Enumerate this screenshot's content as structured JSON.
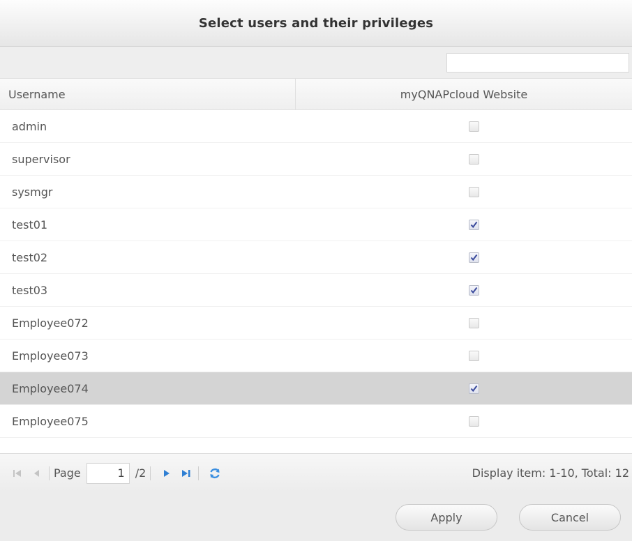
{
  "dialog": {
    "title": "Select users and their privileges"
  },
  "search": {
    "value": "",
    "placeholder": ""
  },
  "table": {
    "columns": [
      "Username",
      "myQNAPcloud Website"
    ],
    "rows": [
      {
        "username": "admin",
        "checked": false
      },
      {
        "username": "supervisor",
        "checked": false
      },
      {
        "username": "sysmgr",
        "checked": false
      },
      {
        "username": "test01",
        "checked": true
      },
      {
        "username": "test02",
        "checked": true
      },
      {
        "username": "test03",
        "checked": true
      },
      {
        "username": "Employee072",
        "checked": false
      },
      {
        "username": "Employee073",
        "checked": false
      },
      {
        "username": "Employee074",
        "checked": true,
        "selected": true
      },
      {
        "username": "Employee075",
        "checked": false
      }
    ]
  },
  "pager": {
    "page_label": "Page",
    "current_page": "1",
    "total_pages_label": "/2",
    "display_info": "Display item: 1-10, Total: 12",
    "icons": {
      "first": "first-page-icon",
      "prev": "prev-page-icon",
      "next": "next-page-icon",
      "last": "last-page-icon",
      "refresh": "refresh-icon"
    }
  },
  "footer": {
    "apply_label": "Apply",
    "cancel_label": "Cancel"
  },
  "colors": {
    "accent_blue": "#2f7fd3",
    "check_blue": "#3a4a9c",
    "selected_row": "#d4d4d4"
  }
}
